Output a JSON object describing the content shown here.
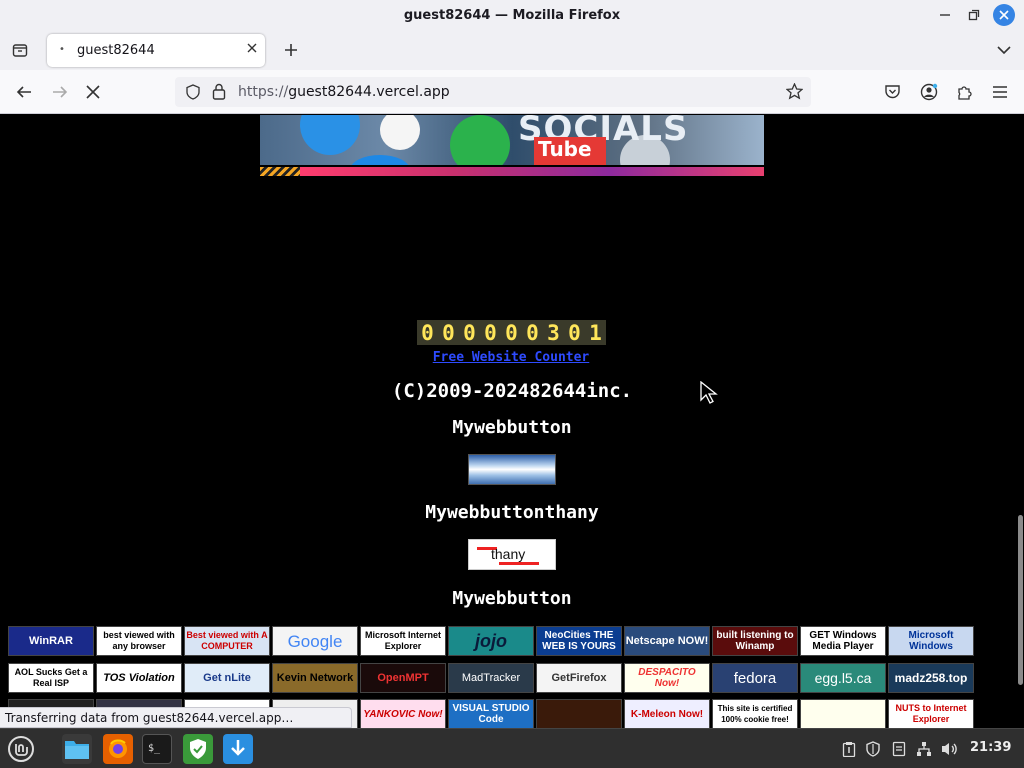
{
  "window": {
    "title": "guest82644 — Mozilla Firefox"
  },
  "tabs": [
    {
      "label": "guest82644"
    }
  ],
  "navbar": {
    "url_scheme": "https://",
    "url_host": "guest82644.vercel.app"
  },
  "page": {
    "banner_text": "SOCIALS",
    "banner_sub": "Tube",
    "counter_digits": [
      "0",
      "0",
      "0",
      "0",
      "0",
      "0",
      "3",
      "0",
      "1"
    ],
    "counter_link": "Free Website Counter",
    "copyright": "(C)2009-202482644inc.",
    "web_button_1": "Mywebbutton",
    "web_button_2": "Mywebbuttonthany",
    "thany_label": "thany",
    "web_button_3": "Mywebbutton",
    "badges_row1": [
      "WinRAR",
      "best viewed with any browser",
      "Best viewed with A COMPUTER",
      "Google",
      "Microsoft Internet Explorer",
      "jojo",
      "NeoCities THE WEB IS YOURS",
      "Netscape NOW!",
      "built listening to Winamp",
      "GET Windows Media Player",
      "Microsoft Windows"
    ],
    "badges_row2": [
      "AOL Sucks Get a Real ISP",
      "TOS Violation",
      "Get nLite",
      "Kevin Network",
      "OpenMPT",
      "MadTracker",
      "GetFirefox",
      "DESPACITO Now!",
      "fedora",
      "egg.l5.ca",
      "madz258.top"
    ],
    "badges_row3": [
      "",
      "",
      "",
      "",
      "YANKOVIC Now!",
      "VISUAL STUDIO Code",
      "",
      "K-Meleon Now!",
      "This site is certified 100% cookie free!",
      "",
      "NUTS to Internet Explorer"
    ]
  },
  "statusbar": {
    "text": "Transferring data from guest82644.vercel.app…"
  },
  "taskbar": {
    "clock": "21:39"
  }
}
